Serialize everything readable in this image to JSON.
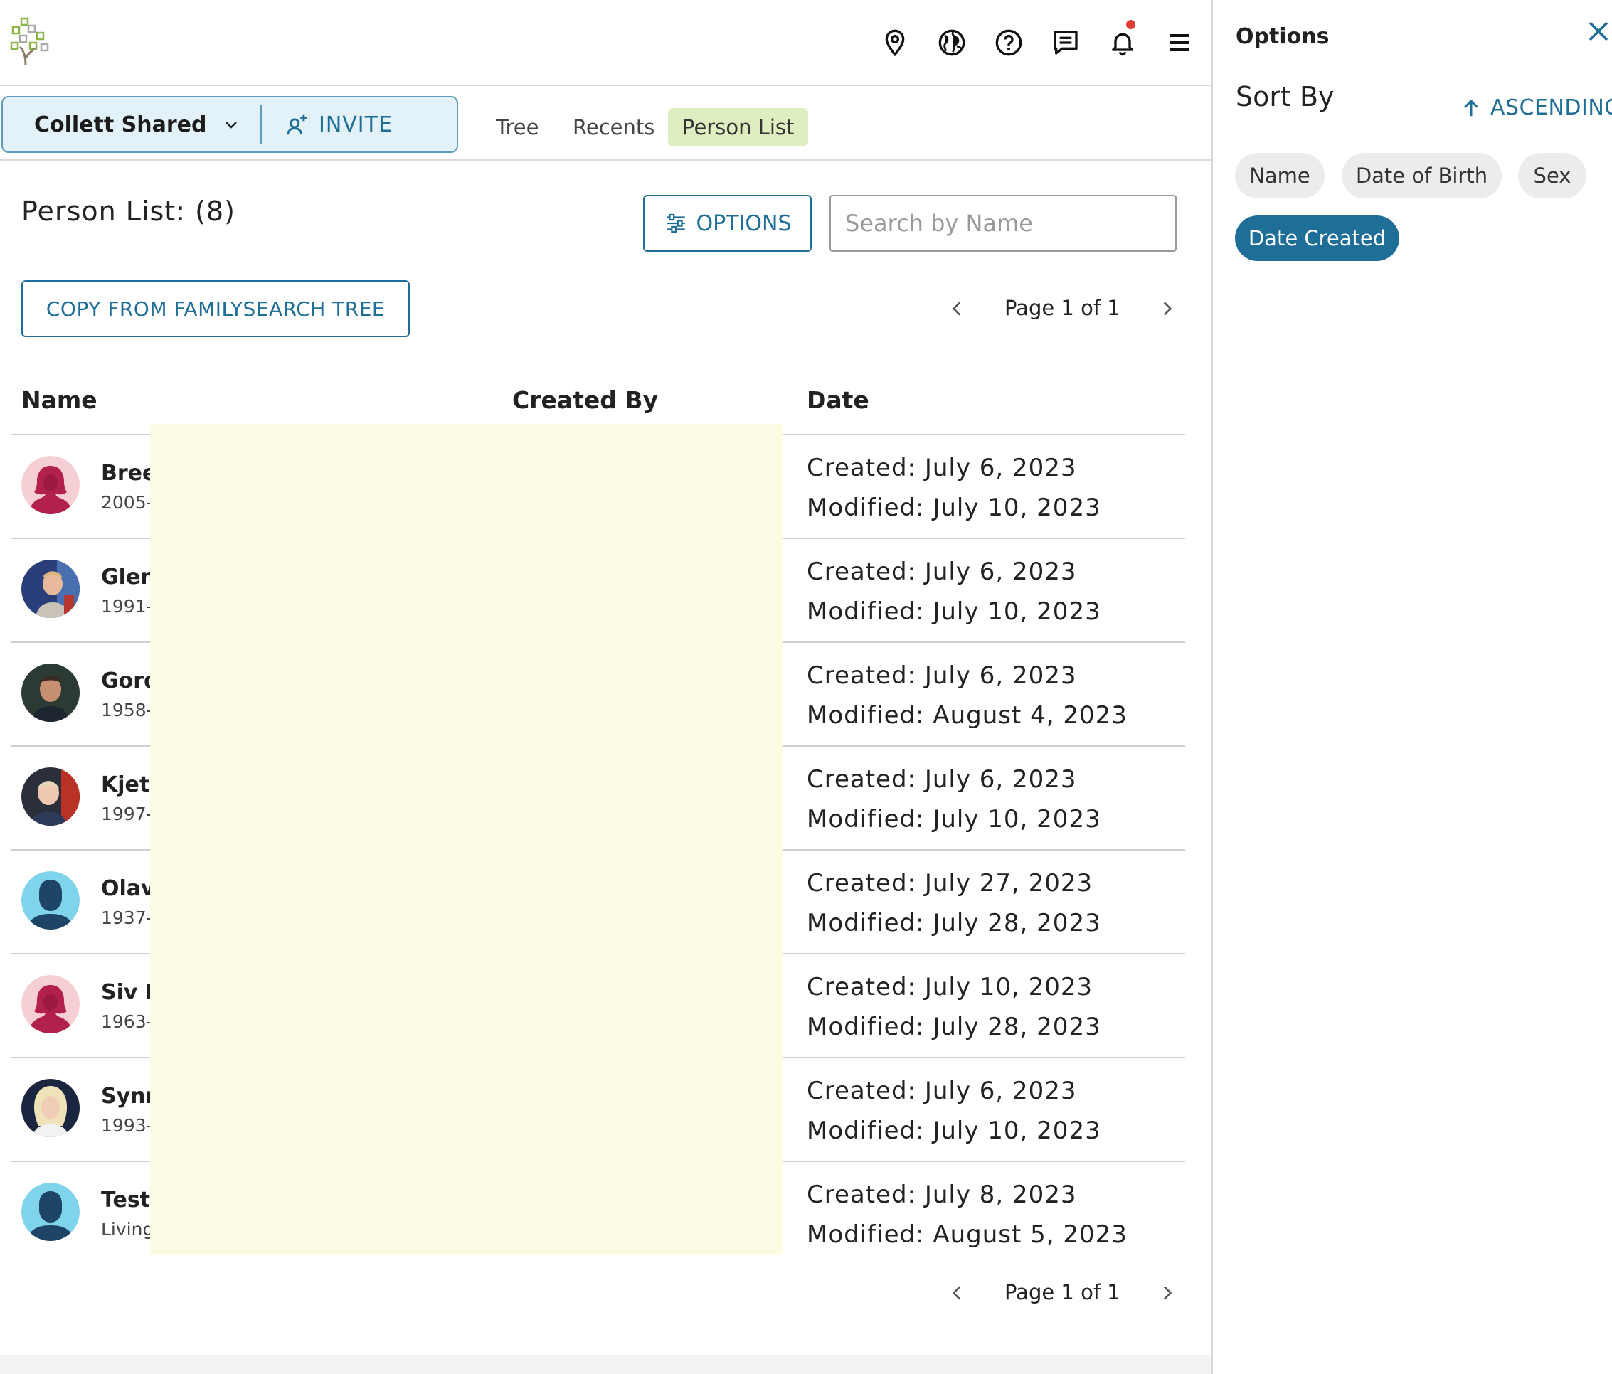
{
  "header": {
    "icons": [
      "location-pin-icon",
      "globe-icon",
      "help-icon",
      "messages-icon",
      "bell-icon",
      "menu-icon"
    ]
  },
  "nav": {
    "tree_name": "Collett Shared",
    "invite_label": "INVITE",
    "tabs": [
      {
        "label": "Tree",
        "active": false
      },
      {
        "label": "Recents",
        "active": false
      },
      {
        "label": "Person List",
        "active": true
      }
    ]
  },
  "main": {
    "title": "Person List: (8)",
    "options_label": "OPTIONS",
    "search_placeholder": "Search by Name",
    "copy_label": "COPY FROM FAMILYSEARCH TREE",
    "page_label": "Page 1 of 1"
  },
  "table": {
    "columns": [
      "Name",
      "Created By",
      "Date"
    ],
    "rows": [
      {
        "name": "Bree",
        "life": "2005-",
        "avatar": "female",
        "created": "Created: July 6, 2023",
        "modified": "Modified: July 10, 2023"
      },
      {
        "name": "Glen",
        "life": "1991-",
        "avatar": "photo-child-blue",
        "created": "Created: July 6, 2023",
        "modified": "Modified: July 10, 2023"
      },
      {
        "name": "Gord",
        "life": "1958-",
        "avatar": "photo-man",
        "created": "Created: July 6, 2023",
        "modified": "Modified: August 4, 2023"
      },
      {
        "name": "Kjeti",
        "life": "1997-",
        "avatar": "photo-child-red",
        "created": "Created: July 6, 2023",
        "modified": "Modified: July 10, 2023"
      },
      {
        "name": "Olav",
        "life": "1937-",
        "avatar": "male",
        "created": "Created: July 27, 2023",
        "modified": "Modified: July 28, 2023"
      },
      {
        "name": "Siv D",
        "life": "1963-",
        "avatar": "female",
        "created": "Created: July 10, 2023",
        "modified": "Modified: July 28, 2023"
      },
      {
        "name": "Synr",
        "life": "1993-",
        "avatar": "photo-woman",
        "created": "Created: July 6, 2023",
        "modified": "Modified: July 10, 2023"
      },
      {
        "name": "Test",
        "life": "Living",
        "avatar": "male",
        "created": "Created: July 8, 2023",
        "modified": "Modified: August 5, 2023"
      }
    ]
  },
  "options_panel": {
    "title": "Options",
    "sort_by": "Sort By",
    "direction": "ASCENDING",
    "sort_options": [
      {
        "label": "Name",
        "active": false
      },
      {
        "label": "Date of Birth",
        "active": false
      },
      {
        "label": "Sex",
        "active": false
      },
      {
        "label": "Date Created",
        "active": true
      }
    ]
  },
  "colors": {
    "accent": "#1f6e98",
    "tab_active_bg": "#dfeec1",
    "chip_bg": "#e3f1f8",
    "redaction": "#fcfbe4",
    "notification": "#e03c31"
  }
}
